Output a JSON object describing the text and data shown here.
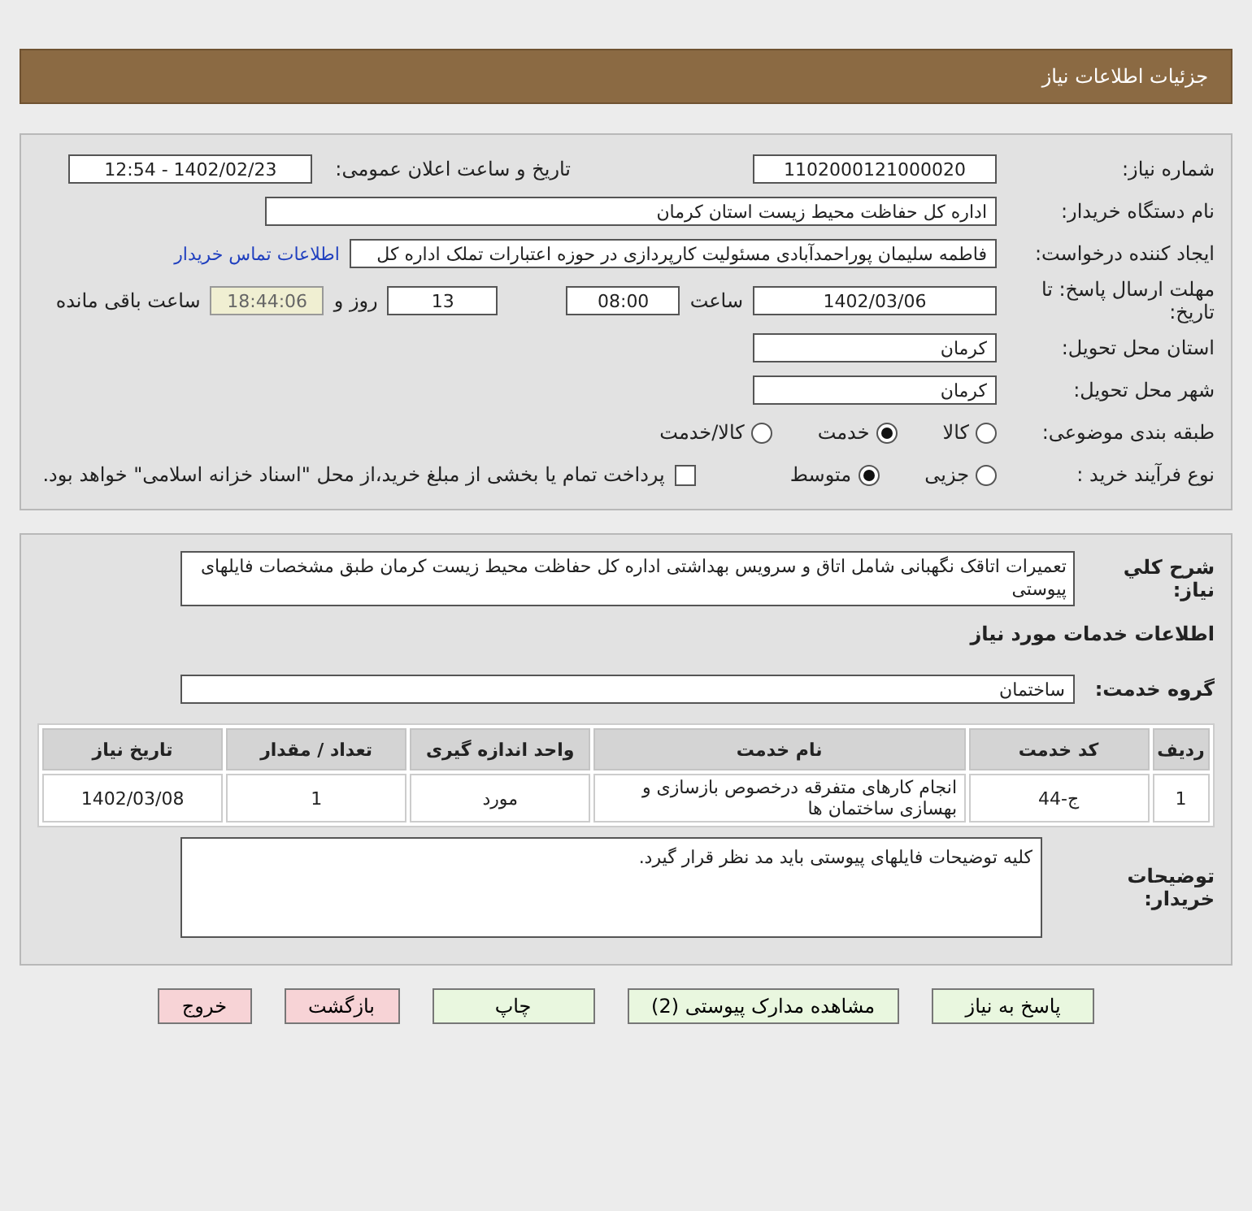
{
  "header": {
    "title": "جزئیات اطلاعات نیاز"
  },
  "details": {
    "need_number": {
      "label": "شماره نیاز:",
      "value": "1102000121000020"
    },
    "announce": {
      "label": "تاریخ و ساعت اعلان عمومی:",
      "value": "1402/02/23 - 12:54"
    },
    "buyer_org": {
      "label": "نام دستگاه خریدار:",
      "value": "اداره کل حفاظت محیط زیست استان کرمان"
    },
    "requester": {
      "label": "ایجاد کننده درخواست:",
      "value": "فاطمه سلیمان پوراحمدآبادی مسئولیت کارپردازی در حوزه اعتبارات تملک اداره کل",
      "link": "اطلاعات تماس خریدار"
    },
    "deadline": {
      "label": "مهلت ارسال پاسخ: تا تاریخ:",
      "date": "1402/03/06",
      "time_label": "ساعت",
      "time": "08:00",
      "days": "13",
      "days_label": "روز و",
      "remaining": "18:44:06",
      "remaining_label": "ساعت باقی مانده"
    },
    "province": {
      "label": "استان محل تحویل:",
      "value": "کرمان"
    },
    "city": {
      "label": "شهر محل تحویل:",
      "value": "کرمان"
    },
    "category": {
      "label": "طبقه بندی موضوعی:",
      "options": [
        {
          "label": "کالا",
          "selected": false
        },
        {
          "label": "خدمت",
          "selected": true
        },
        {
          "label": "کالا/خدمت",
          "selected": false
        }
      ]
    },
    "process": {
      "label": "نوع فرآیند خرید :",
      "options": [
        {
          "label": "جزیی",
          "selected": false
        },
        {
          "label": "متوسط",
          "selected": true
        }
      ],
      "payment_checkbox": {
        "checked": false,
        "text": "پرداخت تمام یا بخشی از مبلغ خرید،از محل \"اسناد خزانه اسلامی\" خواهد بود."
      }
    }
  },
  "need": {
    "summary_label": "شرح کلي نياز:",
    "summary": "تعمیرات اتاقک نگهبانی شامل اتاق و سرویس بهداشتی اداره کل حفاظت محیط زیست کرمان طبق مشخصات فایلهای پیوستی",
    "services_heading": "اطلاعات خدمات مورد نیاز",
    "group_label": "گروه خدمت:",
    "group": "ساختمان",
    "table": {
      "columns": [
        "ردیف",
        "کد خدمت",
        "نام خدمت",
        "واحد اندازه گیری",
        "تعداد / مقدار",
        "تاریخ نیاز"
      ],
      "rows": [
        [
          "1",
          "ج-44",
          "انجام کارهای متفرقه درخصوص بازسازی و بهسازی ساختمان ها",
          "مورد",
          "1",
          "1402/03/08"
        ]
      ]
    },
    "notes_label": "توضیحات خریدار:",
    "notes": "کلیه توضیحات فایلهای پیوستی باید مد نظر قرار گیرد."
  },
  "buttons": [
    {
      "label": "پاسخ به نیاز",
      "kind": "normal"
    },
    {
      "label": "مشاهده مدارک پیوستی (2)",
      "kind": "normal"
    },
    {
      "label": "چاپ",
      "kind": "normal"
    },
    {
      "label": "بازگشت",
      "kind": "danger"
    },
    {
      "label": "خروج",
      "kind": "danger"
    }
  ]
}
